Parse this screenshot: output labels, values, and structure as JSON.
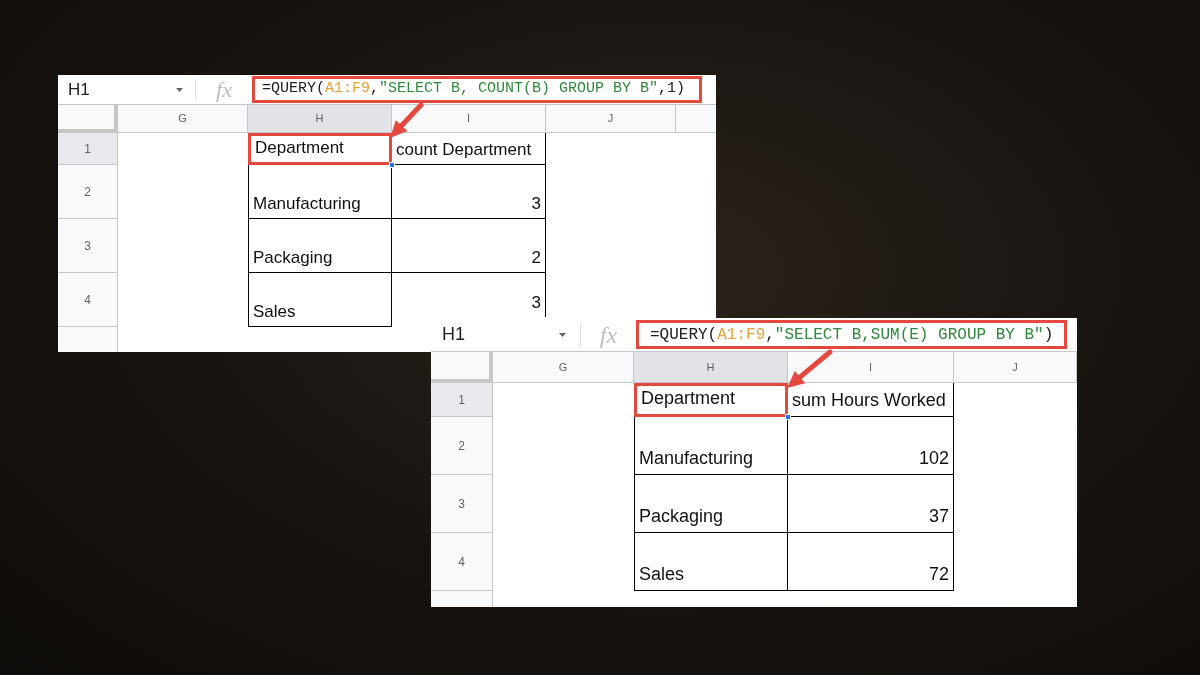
{
  "sheets": [
    {
      "name_box": "H1",
      "function_icon": "fx",
      "formula": {
        "highlighted": true,
        "parts": [
          {
            "kind": "plain",
            "text": "=QUERY("
          },
          {
            "kind": "range",
            "text": "A1:F9"
          },
          {
            "kind": "plain",
            "text": ","
          },
          {
            "kind": "string",
            "text": "\"SELECT B, COUNT(B) GROUP BY B\""
          },
          {
            "kind": "plain",
            "text": ",1)"
          }
        ]
      },
      "arrow": true,
      "columns": [
        {
          "label": "G",
          "selected": false
        },
        {
          "label": "H",
          "selected": true
        },
        {
          "label": "I",
          "selected": false
        },
        {
          "label": "J",
          "selected": false
        }
      ],
      "rows": [
        {
          "number": "1",
          "selected": true,
          "cells": [
            {
              "kind": "empty",
              "text": ""
            },
            {
              "kind": "text",
              "text": "Department",
              "highlighted": true
            },
            {
              "kind": "text",
              "text": "count Department",
              "highlighted": false
            }
          ]
        },
        {
          "number": "2",
          "selected": false,
          "cells": [
            {
              "kind": "empty",
              "text": ""
            },
            {
              "kind": "text",
              "text": "Manufacturing",
              "highlighted": false
            },
            {
              "kind": "number",
              "text": "3",
              "highlighted": false
            }
          ]
        },
        {
          "number": "3",
          "selected": false,
          "cells": [
            {
              "kind": "empty",
              "text": ""
            },
            {
              "kind": "text",
              "text": "Packaging",
              "highlighted": false
            },
            {
              "kind": "number",
              "text": "2",
              "highlighted": false
            }
          ]
        },
        {
          "number": "4",
          "selected": false,
          "cells": [
            {
              "kind": "empty",
              "text": ""
            },
            {
              "kind": "text",
              "text": "Sales",
              "highlighted": false
            },
            {
              "kind": "number",
              "text": "3",
              "highlighted": false
            }
          ]
        }
      ]
    },
    {
      "name_box": "H1",
      "function_icon": "fx",
      "formula": {
        "highlighted": true,
        "parts": [
          {
            "kind": "plain",
            "text": "=QUERY("
          },
          {
            "kind": "range",
            "text": "A1:F9"
          },
          {
            "kind": "plain",
            "text": ","
          },
          {
            "kind": "string",
            "text": "\"SELECT B,SUM(E) GROUP BY B\""
          },
          {
            "kind": "plain",
            "text": ")"
          }
        ]
      },
      "arrow": true,
      "columns": [
        {
          "label": "G",
          "selected": false
        },
        {
          "label": "H",
          "selected": true
        },
        {
          "label": "I",
          "selected": false
        },
        {
          "label": "J",
          "selected": false
        }
      ],
      "rows": [
        {
          "number": "1",
          "selected": true,
          "cells": [
            {
              "kind": "empty",
              "text": ""
            },
            {
              "kind": "text",
              "text": "Department",
              "highlighted": true
            },
            {
              "kind": "text",
              "text": "sum Hours Worked",
              "highlighted": false
            }
          ]
        },
        {
          "number": "2",
          "selected": false,
          "cells": [
            {
              "kind": "empty",
              "text": ""
            },
            {
              "kind": "text",
              "text": "Manufacturing",
              "highlighted": false
            },
            {
              "kind": "number",
              "text": "102",
              "highlighted": false
            }
          ]
        },
        {
          "number": "3",
          "selected": false,
          "cells": [
            {
              "kind": "empty",
              "text": ""
            },
            {
              "kind": "text",
              "text": "Packaging",
              "highlighted": false
            },
            {
              "kind": "number",
              "text": "37",
              "highlighted": false
            }
          ]
        },
        {
          "number": "4",
          "selected": false,
          "cells": [
            {
              "kind": "empty",
              "text": ""
            },
            {
              "kind": "text",
              "text": "Sales",
              "highlighted": false
            },
            {
              "kind": "number",
              "text": "72",
              "highlighted": false
            }
          ]
        }
      ]
    }
  ]
}
